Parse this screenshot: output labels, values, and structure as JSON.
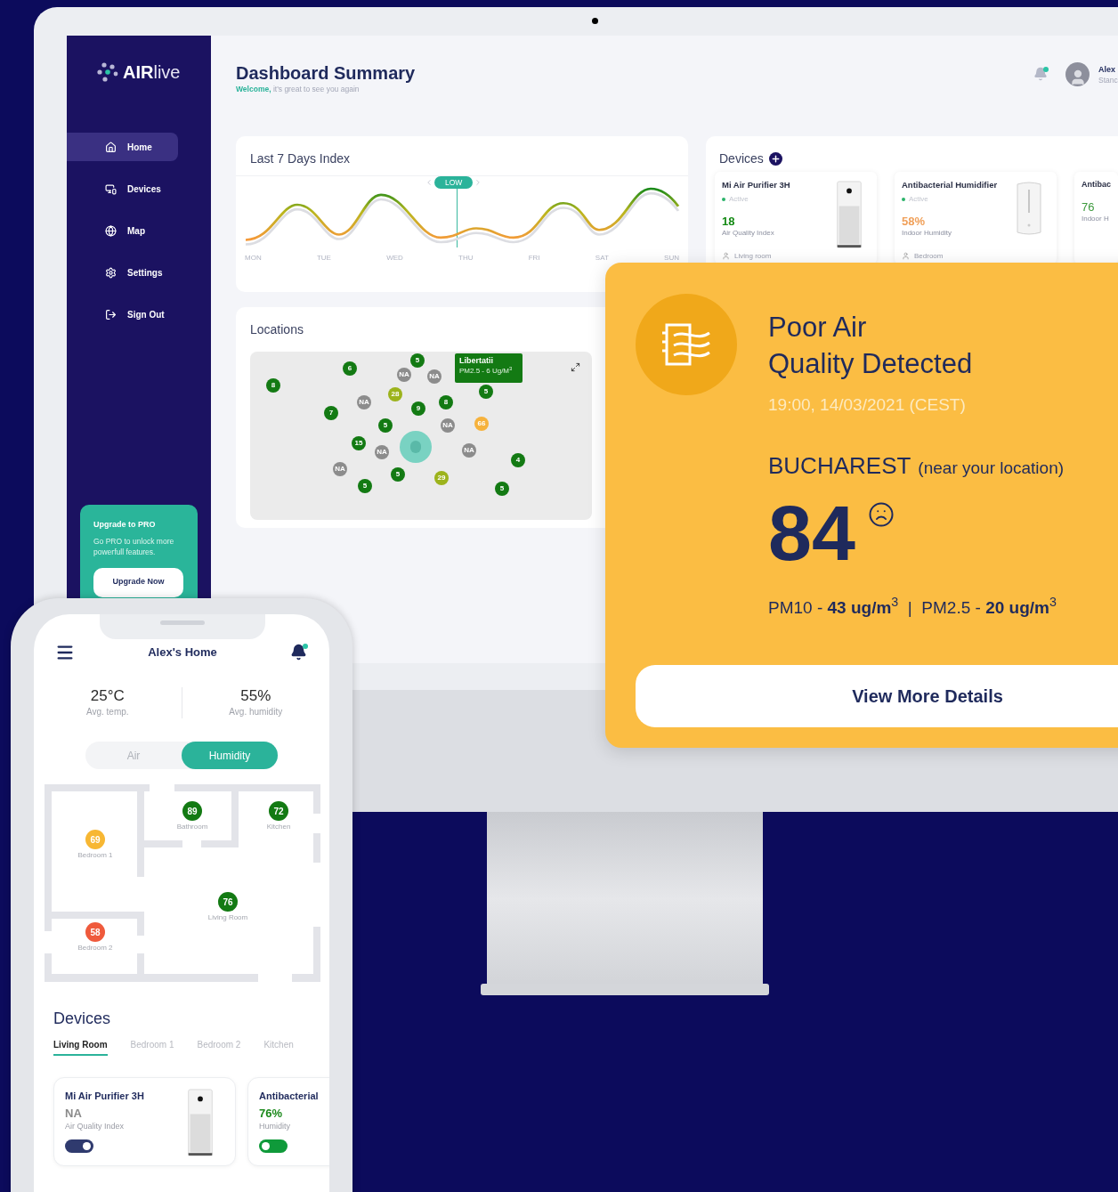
{
  "monitor": {
    "sidebar": {
      "logo": {
        "bold": "AIR",
        "light": "live"
      },
      "nav": [
        {
          "label": "Home",
          "selected": true
        },
        {
          "label": "Devices",
          "selected": false
        },
        {
          "label": "Map",
          "selected": false
        },
        {
          "label": "Settings",
          "selected": false
        },
        {
          "label": "Sign Out",
          "selected": false
        }
      ],
      "upgrade": {
        "title": "Upgrade to PRO",
        "text": "Go PRO to unlock more powerfull features.",
        "button": "Upgrade Now"
      }
    },
    "header": {
      "title": "Dashboard Summary",
      "subtitle": "**Welcome,** it's great to see you again",
      "has_notification": true,
      "user_name": "Alex",
      "user_role": "Stanc"
    },
    "chart_card": {
      "title": "Last 7 Days Index",
      "badge": "LOW",
      "days": [
        "MON",
        "TUE",
        "WED",
        "THU",
        "FRI",
        "SAT",
        "SUN"
      ]
    },
    "locations": {
      "title": "Locations",
      "tooltip": {
        "title": "Libertatii",
        "text": "PM2.5 - 6 Ug/M$^{3}$"
      },
      "markers": [
        {
          "label": "8",
          "color": "#137a13"
        },
        {
          "label": "6",
          "color": "#137a13"
        },
        {
          "label": "5",
          "color": "#137a13"
        },
        {
          "label": "NA",
          "color": "#8c8c8c"
        },
        {
          "label": "NA",
          "color": "#8c8c8c"
        },
        {
          "label": "28",
          "color": "#9cb31c"
        },
        {
          "label": "NA",
          "color": "#8c8c8c"
        },
        {
          "label": "7",
          "color": "#137a13"
        },
        {
          "label": "9",
          "color": "#137a13"
        },
        {
          "label": "8",
          "color": "#137a13"
        },
        {
          "label": "5",
          "color": "#137a13"
        },
        {
          "label": "NA",
          "color": "#8c8c8c"
        },
        {
          "label": "66",
          "color": "#f6b23c"
        },
        {
          "label": "15",
          "color": "#137a13"
        },
        {
          "label": "NA",
          "color": "#8c8c8c"
        },
        {
          "label": "NA",
          "color": "#8c8c8c"
        },
        {
          "label": "4",
          "color": "#137a13"
        },
        {
          "label": "NA",
          "color": "#8c8c8c"
        },
        {
          "label": "5",
          "color": "#137a13"
        },
        {
          "label": "29",
          "color": "#9cb31c"
        },
        {
          "label": "5",
          "color": "#137a13"
        },
        {
          "label": "5",
          "color": "#137a13"
        },
        {
          "label": "5",
          "color": "#137a13"
        }
      ]
    },
    "devices": {
      "title": "Devices",
      "cards": [
        {
          "name": "Mi Air Purifier 3H",
          "status": "Active",
          "active": true,
          "value": "18",
          "color": "#148a14",
          "metric": "Air Quality Index",
          "location": "Living room",
          "kind": "purifier"
        },
        {
          "name": "Antibacterial Humidifier",
          "status": "Active",
          "active": true,
          "value": "58%",
          "color": "#f0a05a",
          "metric": "Indoor Humidity",
          "location": "Bedroom",
          "kind": "humidifier"
        },
        {
          "name": "Antibac",
          "value": "76",
          "color": "#3d9a3d",
          "metric": "Indoor H",
          "kind": "none"
        }
      ]
    }
  },
  "alert": {
    "title_lines": [
      "Poor Air",
      "Quality Detected"
    ],
    "time": "19:00, 14/03/2021 (CEST)",
    "city": "BUCHAREST",
    "city_note": "(near your location)",
    "value": "84",
    "readings": "PM10 - **43 ug/m**$^{3}$  |  PM2.5 - **20 ug/m**$^{3}$",
    "button": "View More Details"
  },
  "phone": {
    "title": "Alex's Home",
    "has_notification": true,
    "stats": [
      {
        "value": "25°C",
        "label": "Avg. temp."
      },
      {
        "value": "55%",
        "label": "Avg. humidity"
      }
    ],
    "modes": [
      {
        "label": "Air",
        "selected": false
      },
      {
        "label": "Humidity",
        "selected": true
      }
    ],
    "rooms": [
      {
        "name": "Bedroom 1",
        "value": "69",
        "color": "#f7b733"
      },
      {
        "name": "Bathroom",
        "value": "89",
        "color": "#137a13"
      },
      {
        "name": "Kitchen",
        "value": "72",
        "color": "#137a13"
      },
      {
        "name": "Living Room",
        "value": "76",
        "color": "#137a13"
      },
      {
        "name": "Bedroom 2",
        "value": "58",
        "color": "#ef5a3c"
      }
    ],
    "devices_title": "Devices",
    "device_tabs": [
      {
        "label": "Living Room",
        "selected": true
      },
      {
        "label": "Bedroom 1",
        "selected": false
      },
      {
        "label": "Bedroom 2",
        "selected": false
      },
      {
        "label": "Kitchen",
        "selected": false
      }
    ],
    "devices": [
      {
        "name": "Mi Air Purifier 3H",
        "value": "NA",
        "color": "#8a8a8a",
        "metric": "Air Quality Index",
        "toggle": {
          "on": true,
          "color": "#2f3a6e"
        },
        "kind": "purifier"
      },
      {
        "name": "Antibacterial",
        "value": "76%",
        "color": "#1d8a1d",
        "metric": "Humidity",
        "toggle": {
          "on": false,
          "color": "#0f9a3a"
        },
        "kind": "none"
      }
    ]
  }
}
